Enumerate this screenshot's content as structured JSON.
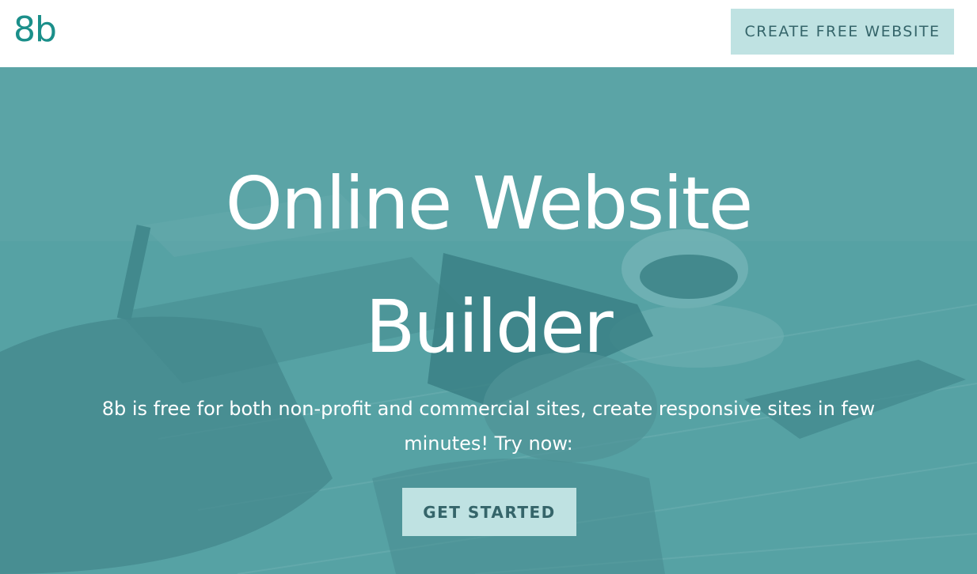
{
  "header": {
    "logo_text": "8b",
    "cta_label": "CREATE FREE WEBSITE"
  },
  "hero": {
    "title_line1": "Online Website",
    "title_line2": "Builder",
    "subtitle": "8b is free for both non-profit and commercial sites, create responsive sites in few minutes! Try now:",
    "cta_label": "GET STARTED"
  },
  "colors": {
    "brand": "#1b8f8a",
    "button_bg": "#bfe2e2",
    "button_text": "#35656a",
    "hero_tint": "#5aa4a7"
  }
}
